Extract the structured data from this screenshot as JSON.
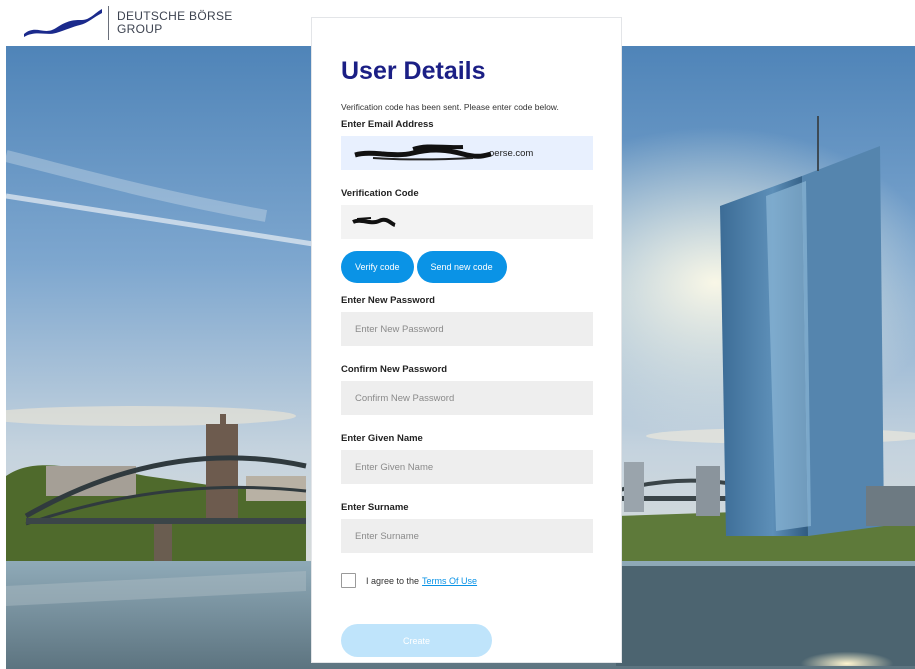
{
  "header": {
    "logo_line1": "DEUTSCHE BÖRSE",
    "logo_line2": "GROUP"
  },
  "form": {
    "title": "User Details",
    "notice": "Verification code has been sent. Please enter code below.",
    "email": {
      "label": "Enter Email Address",
      "value": "oerse.com"
    },
    "verification": {
      "label": "Verification Code"
    },
    "verify_button": "Verify code",
    "send_new_button": "Send new code",
    "new_password": {
      "label": "Enter New Password",
      "placeholder": "Enter New Password"
    },
    "confirm_password": {
      "label": "Confirm New Password",
      "placeholder": "Confirm New Password"
    },
    "given_name": {
      "label": "Enter Given Name",
      "placeholder": "Enter Given Name"
    },
    "surname": {
      "label": "Enter Surname",
      "placeholder": "Enter Surname"
    },
    "terms_prefix": "I agree to the",
    "terms_link": "Terms Of Use",
    "create_button": "Create"
  },
  "colors": {
    "title": "#1b1f85",
    "primary_button": "#0a93e6",
    "create_disabled": "#bfe4fb",
    "email_autofill": "#e8f0fe"
  }
}
